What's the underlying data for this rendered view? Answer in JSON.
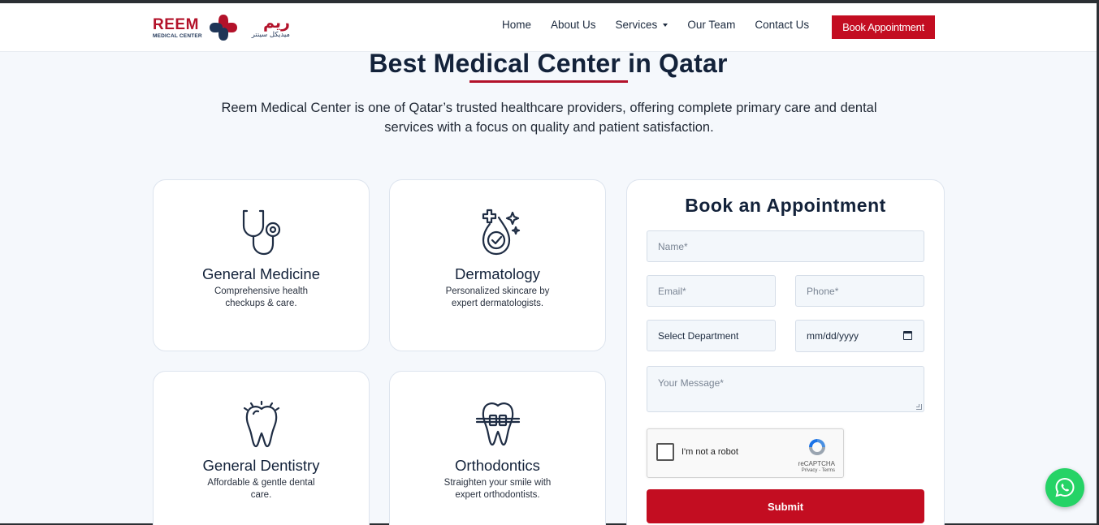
{
  "header": {
    "logo": {
      "en_name": "REEM",
      "en_sub": "MEDICAL CENTER",
      "ar_name": "ريم",
      "ar_sub": "ميديكل سينتر"
    },
    "nav": [
      {
        "label": "Home"
      },
      {
        "label": "About Us"
      },
      {
        "label": "Services",
        "has_dropdown": true
      },
      {
        "label": "Our Team"
      },
      {
        "label": "Contact Us"
      }
    ],
    "cta_label": "Book Appointment"
  },
  "hero": {
    "title": "Best Medical Center in Qatar",
    "subtitle": "Reem Medical Center is one of Qatar’s trusted healthcare providers, offering complete primary care and dental services with a focus on quality and patient satisfaction."
  },
  "services": [
    {
      "icon": "stethoscope-icon",
      "title": "General Medicine",
      "desc": "Comprehensive health checkups & care."
    },
    {
      "icon": "skincare-drop-icon",
      "title": "Dermatology",
      "desc": "Personalized skincare by expert dermatologists."
    },
    {
      "icon": "tooth-icon",
      "title": "General Dentistry",
      "desc": "Affordable & gentle dental care."
    },
    {
      "icon": "braces-tooth-icon",
      "title": "Orthodontics",
      "desc": "Straighten your smile with expert orthodontists."
    }
  ],
  "form": {
    "title": "Book an Appointment",
    "name_placeholder": "Name*",
    "email_placeholder": "Email*",
    "phone_placeholder": "Phone*",
    "department_value": "Select Department",
    "date_value": "mm/dd/yyyy",
    "message_placeholder": "Your Message*",
    "captcha": {
      "label": "I'm not a robot",
      "brand": "reCAPTCHA",
      "links": "Privacy - Terms"
    },
    "submit_label": "Submit"
  },
  "floating": {
    "icon": "whatsapp-icon"
  },
  "colors": {
    "accent": "#c30d21",
    "heading": "#13223a",
    "whatsapp": "#25d366"
  }
}
